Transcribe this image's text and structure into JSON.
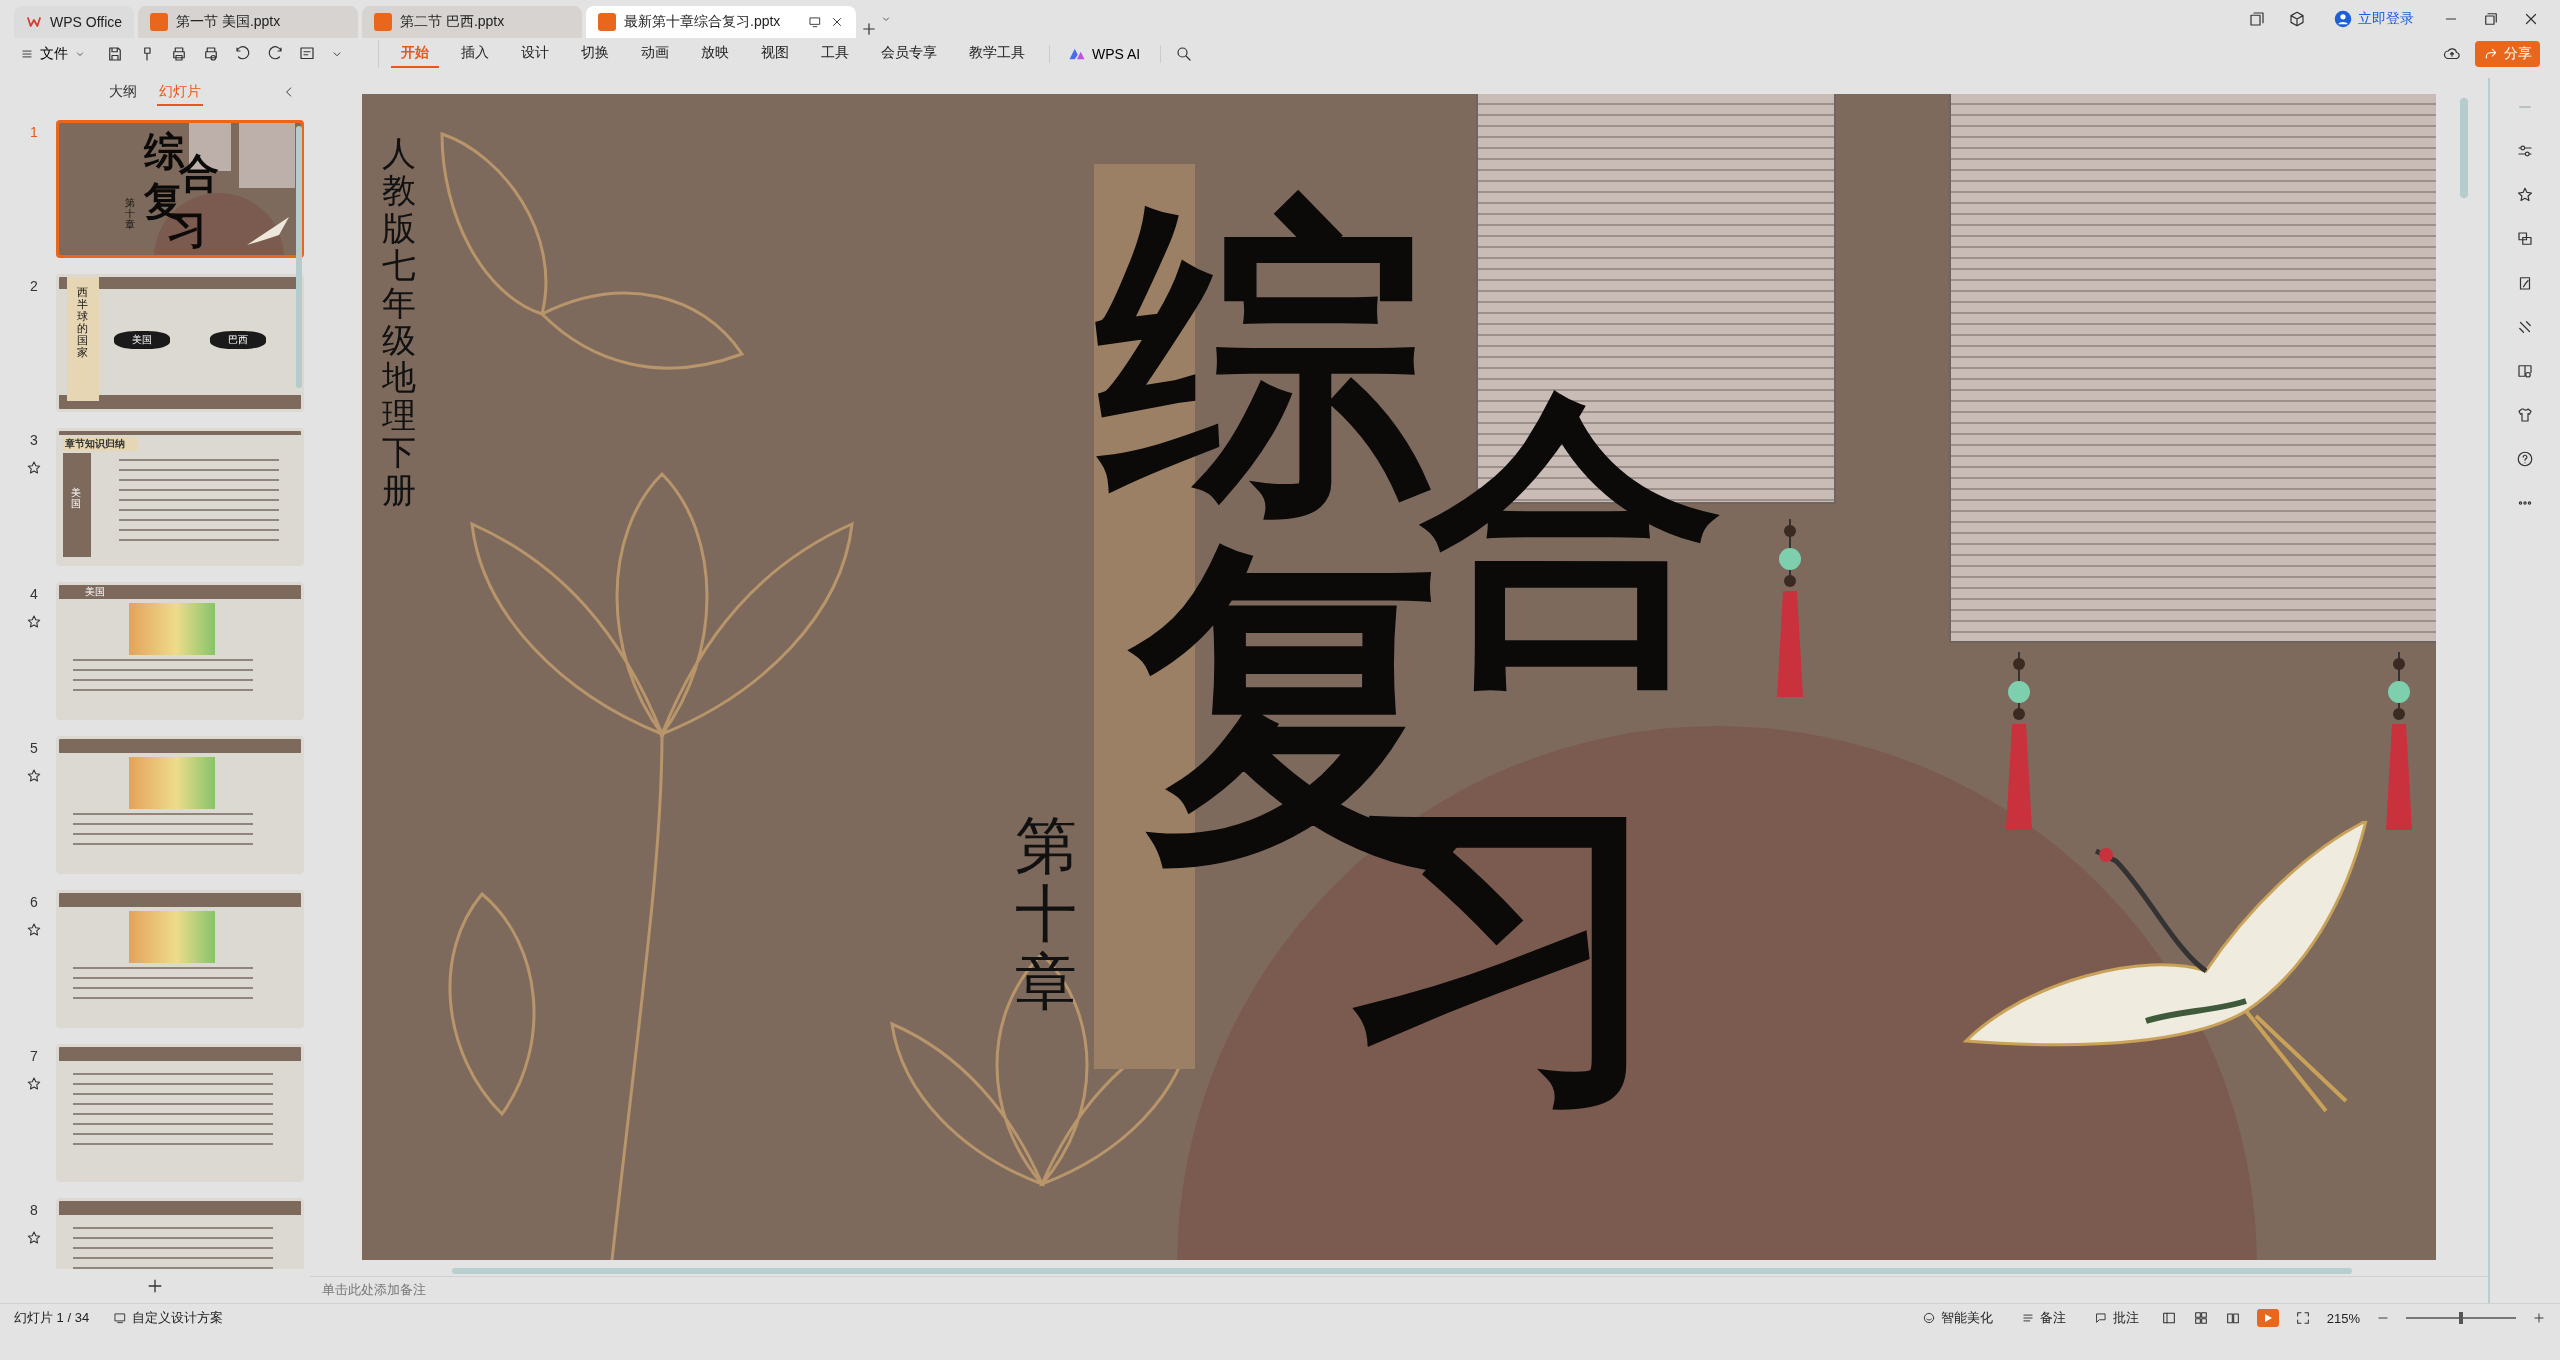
{
  "tabs": [
    {
      "label": "WPS Office",
      "kind": "home",
      "selected": false
    },
    {
      "label": "第一节 美国.pptx",
      "kind": "doc",
      "selected": false
    },
    {
      "label": "第二节 巴西.pptx",
      "kind": "doc",
      "selected": false
    },
    {
      "label": "最新第十章综合复习.pptx",
      "kind": "doc",
      "selected": true
    }
  ],
  "account": {
    "login": "立即登录"
  },
  "menu": {
    "file": "文件",
    "tabs": [
      {
        "label": "开始",
        "selected": true
      },
      {
        "label": "插入",
        "selected": false
      },
      {
        "label": "设计",
        "selected": false
      },
      {
        "label": "切换",
        "selected": false
      },
      {
        "label": "动画",
        "selected": false
      },
      {
        "label": "放映",
        "selected": false
      },
      {
        "label": "视图",
        "selected": false
      },
      {
        "label": "工具",
        "selected": false
      },
      {
        "label": "会员专享",
        "selected": false
      },
      {
        "label": "教学工具",
        "selected": false
      }
    ],
    "ai": "WPS AI",
    "share": "分享"
  },
  "panel": {
    "tabs": [
      {
        "label": "大纲",
        "selected": false
      },
      {
        "label": "幻灯片",
        "selected": true
      }
    ],
    "slides": [
      {
        "number": "1",
        "kind": "title",
        "selected": true,
        "animated": false,
        "texts": [
          "综",
          "合",
          "复",
          "习",
          "第十章"
        ]
      },
      {
        "number": "2",
        "kind": "section",
        "selected": false,
        "animated": false,
        "texts": [
          "西半球的国家",
          "美国",
          "巴西"
        ]
      },
      {
        "number": "3",
        "kind": "summary",
        "selected": false,
        "animated": true,
        "texts": [
          "章节知识归纳",
          "美国"
        ]
      },
      {
        "number": "4",
        "kind": "map",
        "selected": false,
        "animated": true,
        "texts": [
          "美国"
        ]
      },
      {
        "number": "5",
        "kind": "map",
        "selected": false,
        "animated": true
      },
      {
        "number": "6",
        "kind": "map",
        "selected": false,
        "animated": true
      },
      {
        "number": "7",
        "kind": "text",
        "selected": false,
        "animated": true
      },
      {
        "number": "8",
        "kind": "text",
        "selected": false,
        "animated": true
      }
    ]
  },
  "slide": {
    "subtitle": "人教版七年级地理下册",
    "title_chars": [
      "综",
      "合",
      "复",
      "习"
    ],
    "chapter": "第十章"
  },
  "notes": {
    "placeholder": "单击此处添加备注"
  },
  "status": {
    "slide_counter": "幻灯片 1 / 34",
    "design": "自定义设计方案",
    "beautify": "智能美化",
    "notes": "备注",
    "comments": "批注",
    "zoom": "215%",
    "zoom_level": {
      "level": 0.5
    }
  }
}
